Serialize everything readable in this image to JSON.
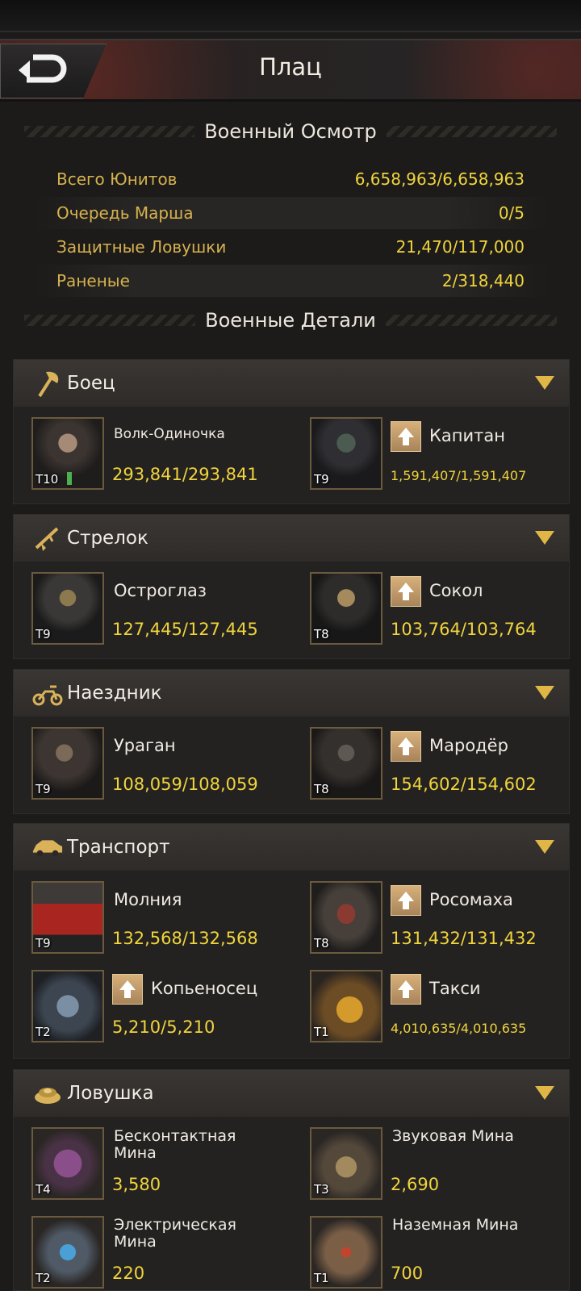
{
  "header": {
    "title": "Плац"
  },
  "overview": {
    "heading": "Военный Осмотр",
    "rows": [
      {
        "label": "Всего Юнитов",
        "value": "6,658,963/6,658,963"
      },
      {
        "label": "Очередь Марша",
        "value": "0/5"
      },
      {
        "label": "Защитные Ловушки",
        "value": "21,470/117,000"
      },
      {
        "label": "Раненые",
        "value": "2/318,440"
      }
    ]
  },
  "details": {
    "heading": "Военные Детали"
  },
  "categories": [
    {
      "name": "Боец",
      "icon": "axe-icon",
      "units": [
        {
          "name": "Волк-Одиночка",
          "tier": "T10",
          "count": "293,841/293,841",
          "upgrade": false
        },
        {
          "name": "Капитан",
          "tier": "T9",
          "count": "1,591,407/1,591,407",
          "upgrade": true
        }
      ]
    },
    {
      "name": "Стрелок",
      "icon": "rifle-icon",
      "units": [
        {
          "name": "Остроглаз",
          "tier": "T9",
          "count": "127,445/127,445",
          "upgrade": false
        },
        {
          "name": "Сокол",
          "tier": "T8",
          "count": "103,764/103,764",
          "upgrade": true
        }
      ]
    },
    {
      "name": "Наездник",
      "icon": "motorcycle-icon",
      "units": [
        {
          "name": "Ураган",
          "tier": "T9",
          "count": "108,059/108,059",
          "upgrade": false
        },
        {
          "name": "Мародёр",
          "tier": "T8",
          "count": "154,602/154,602",
          "upgrade": true
        }
      ]
    },
    {
      "name": "Транспорт",
      "icon": "car-icon",
      "units": [
        {
          "name": "Молния",
          "tier": "T9",
          "count": "132,568/132,568",
          "upgrade": false
        },
        {
          "name": "Росомаха",
          "tier": "T8",
          "count": "131,432/131,432",
          "upgrade": true
        },
        {
          "name": "Копьеносец",
          "tier": "T2",
          "count": "5,210/5,210",
          "upgrade": true
        },
        {
          "name": "Такси",
          "tier": "T1",
          "count": "4,010,635/4,010,635",
          "upgrade": true
        }
      ]
    },
    {
      "name": "Ловушка",
      "icon": "mine-icon",
      "units": [
        {
          "name": "Бесконтактная Мина",
          "tier": "T4",
          "count": "3,580",
          "upgrade": false
        },
        {
          "name": "Звуковая Мина",
          "tier": "T3",
          "count": "2,690",
          "upgrade": false
        },
        {
          "name": "Электрическая Мина",
          "tier": "T2",
          "count": "220",
          "upgrade": false
        },
        {
          "name": "Наземная Мина",
          "tier": "T1",
          "count": "700",
          "upgrade": false
        }
      ]
    }
  ],
  "colors": {
    "accent_gold": "#f0d43c",
    "label_gold": "#d6b24e",
    "toggle": "#e0b646"
  }
}
